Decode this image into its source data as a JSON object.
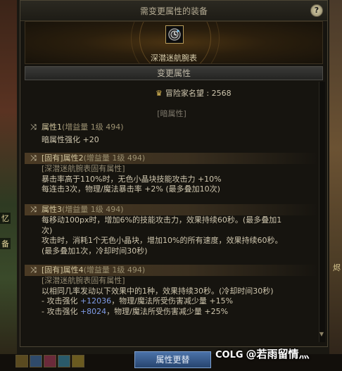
{
  "window": {
    "title": "需变更属性的装备",
    "help_label": "?"
  },
  "equipment": {
    "item_name": "深潜迷航腕表"
  },
  "section": {
    "title": "变更属性"
  },
  "fame": {
    "label": "冒险家名望 : 2568",
    "icon": "fame-icon"
  },
  "dark_header": "[暗属性]",
  "attributes": [
    {
      "header": "属性1",
      "paren": "(增益量 1级 494)",
      "lines": [
        {
          "text": "暗属性强化 +20"
        }
      ]
    },
    {
      "header": "[固有]属性2",
      "paren": "(增益量 1级 494)",
      "lines": [
        {
          "text": "[深潜迷航腕表固有属性]",
          "muted": true
        },
        {
          "text": "暴击率高于110%时，无色小晶块技能攻击力 +10%"
        },
        {
          "text": "每连击3次，物理/魔法暴击率 +2% (最多叠加10次)"
        }
      ]
    },
    {
      "header": "属性3",
      "paren": "(增益量 1级 494)",
      "lines": [
        {
          "text": "每移动100px时，增加6%的技能攻击力，效果持续60秒。(最多叠加1"
        },
        {
          "text": "次)"
        },
        {
          "text": "攻击时，消耗1个无色小晶块，增加10%的所有速度，效果持续60秒。"
        },
        {
          "text": "(最多叠加1次，冷却时间30秒)"
        }
      ]
    },
    {
      "header": "[固有]属性4",
      "paren": "(增益量 1级 494)",
      "lines": [
        {
          "text": "[深潜迷航腕表固有属性]",
          "muted": true
        },
        {
          "text": "以相同几率发动以下效果中的1种，效果持续30秒。(冷却时间30秒)"
        },
        {
          "pre": "- 攻击强化 ",
          "blue": "+12036",
          "post": "，物理/魔法所受伤害减少量 +15%"
        },
        {
          "pre": "- 攻击强化 ",
          "blue": "+8024",
          "post": "，物理/魔法所受伤害减少量 +25%"
        }
      ]
    }
  ],
  "buttons": {
    "change_attr": "属性更替"
  },
  "world": {
    "left_tag_1": "忆",
    "left_tag_2": "备",
    "right_tag": "烬"
  },
  "watermark": {
    "logo": "COLG",
    "text": "@若雨留情灬"
  },
  "colors": {
    "accent_gold": "#d2c69e",
    "value_blue": "#7f9be6",
    "button_blue": "#3a5f95"
  }
}
